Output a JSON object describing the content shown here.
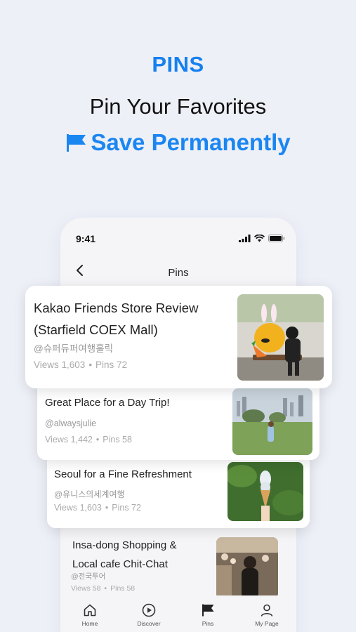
{
  "hero": {
    "tag": "PINS",
    "title": "Pin Your Favorites",
    "subtitle": "Save Permanently",
    "accent_color": "#1a86f2",
    "icon": "flag-icon"
  },
  "phone": {
    "status_time": "9:41",
    "nav_title": "Pins"
  },
  "cards": [
    {
      "title_line1": "Kakao Friends Store Review",
      "title_line2": "(Starfield COEX Mall)",
      "author": "@슈퍼듀퍼여행홀릭",
      "views": "Views 1,603",
      "pins": "Pins 72"
    },
    {
      "title": "Great Place for a Day Trip!",
      "author": "@alwaysjulie",
      "views": "Views 1,442",
      "pins": "Pins 58"
    },
    {
      "title": "Seoul for a Fine Refreshment",
      "author": "@유니스의세계여행",
      "views": "Views 1,603",
      "pins": "Pins 72"
    },
    {
      "title_line1": "Insa-dong Shopping &",
      "title_line2": "Local cafe Chit-Chat",
      "author": "@전국투어",
      "views": "Views 58",
      "pins": "Pins 58"
    }
  ],
  "tabs": [
    {
      "label": "Home",
      "icon": "home-icon"
    },
    {
      "label": "Discover",
      "icon": "discover-icon"
    },
    {
      "label": "Pins",
      "icon": "flag-icon"
    },
    {
      "label": "My Page",
      "icon": "person-icon"
    }
  ]
}
